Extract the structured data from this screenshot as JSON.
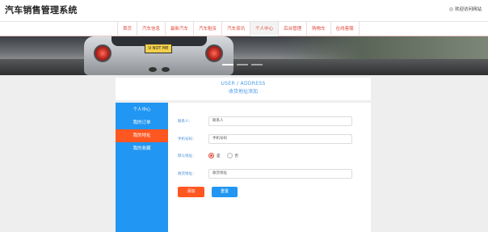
{
  "header": {
    "site_title": "汽车销售管理系统",
    "welcome_text": "欢迎访问网站"
  },
  "nav": {
    "items": [
      {
        "label": "首页",
        "active": false
      },
      {
        "label": "汽车信息",
        "active": false
      },
      {
        "label": "最新汽车",
        "active": false
      },
      {
        "label": "汽车租赁",
        "active": false
      },
      {
        "label": "汽车资讯",
        "active": false
      },
      {
        "label": "个人中心",
        "active": true
      },
      {
        "label": "后台管理",
        "active": false
      },
      {
        "label": "购物车",
        "active": false
      },
      {
        "label": "在线客服",
        "active": false
      }
    ]
  },
  "banner": {
    "plate_text": "U NOT ME"
  },
  "section": {
    "title_en": "USER / ADDRESS",
    "title_cn": "收货地址添加"
  },
  "sidebar": {
    "items": [
      {
        "label": "个人中心",
        "active": false
      },
      {
        "label": "我的订单",
        "active": false
      },
      {
        "label": "我的地址",
        "active": true
      },
      {
        "label": "我的收藏",
        "active": false
      }
    ]
  },
  "form": {
    "contact_label": "联系人：",
    "contact_placeholder": "联系人",
    "phone_label": "手机号码：",
    "phone_placeholder": "手机号码",
    "default_label": "默认地址：",
    "default_yes": "是",
    "default_no": "否",
    "address_label": "收货地址：",
    "address_placeholder": "收货地址",
    "add_button": "添加",
    "reset_button": "重置"
  },
  "colors": {
    "accent_red": "#ff5722",
    "accent_blue": "#2196f3",
    "nav_text": "#e04a3a"
  }
}
